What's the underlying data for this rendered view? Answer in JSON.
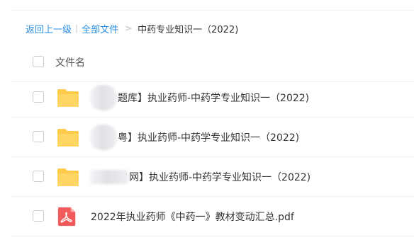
{
  "breadcrumb": {
    "back": "返回上一级",
    "separator": "|",
    "all_files": "全部文件",
    "chevron": ">",
    "current": "中药专业知识一（2022)"
  },
  "table": {
    "header": "文件名",
    "rows": [
      {
        "type": "folder",
        "icon": "folder-icon",
        "name_visible": "题库】执业药师-中药学专业知识一（2022)"
      },
      {
        "type": "folder",
        "icon": "folder-icon",
        "name_visible": "粤】执业药师-中药学专业知识一（2022)"
      },
      {
        "type": "folder",
        "icon": "folder-icon",
        "name_visible": "网】执业药师-中药学专业知识一（2022)"
      },
      {
        "type": "pdf",
        "icon": "pdf-icon",
        "name_visible": "2022年执业药师《中药一》教材变动汇总.pdf"
      }
    ]
  },
  "colors": {
    "link": "#2a8ee6",
    "folder": "#ffc94a",
    "pdf": "#f05a5a"
  }
}
